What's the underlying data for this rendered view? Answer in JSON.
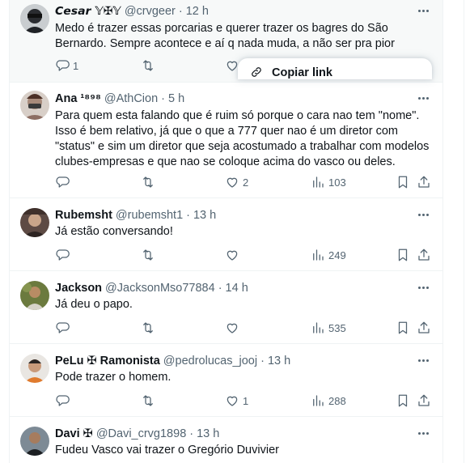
{
  "tweets": [
    {
      "name": "𝘾𝙚𝙨𝙖𝙧 𝕐✠𝕐",
      "handle": "@crvgeer",
      "dot": "·",
      "time": "12 h",
      "text": "Medo é trazer essas porcarias e querer trazer os bagres do São Bernardo. Sempre acontece e aí q nada muda, a não ser pra pior",
      "replies": "1",
      "retweets": "",
      "likes": "",
      "views": ""
    },
    {
      "name": "Ana ¹⁸⁹⁸",
      "handle": "@AthCion",
      "dot": "·",
      "time": "5 h",
      "text": "Para quem esta falando que é ruim só porque o cara nao tem \"nome\". Isso é bem relativo, já que o que a 777 quer nao é um diretor com \"status\" e sim um diretor que seja acostumado a trabalhar com modelos clubes-empresas e que nao se coloque acima do vasco ou deles.",
      "replies": "",
      "retweets": "",
      "likes": "2",
      "views": "103"
    },
    {
      "name": "Rubemsht",
      "handle": "@rubemsht1",
      "dot": "·",
      "time": "13 h",
      "text": "Já estão conversando!",
      "replies": "",
      "retweets": "",
      "likes": "",
      "views": "249"
    },
    {
      "name": "Jackson",
      "handle": "@JacksonMso77884",
      "dot": "·",
      "time": "14 h",
      "text": "Já deu o papo.",
      "replies": "",
      "retweets": "",
      "likes": "",
      "views": "535"
    },
    {
      "name": "PeLu ✠ Ramonista",
      "handle": "@pedrolucas_jooj",
      "dot": "·",
      "time": "13 h",
      "text": "Pode trazer o homem.",
      "replies": "",
      "retweets": "",
      "likes": "1",
      "views": "288"
    },
    {
      "name": "Davi ✠",
      "handle": "@Davi_crvg1898",
      "dot": "·",
      "time": "13 h",
      "text": "Fudeu Vasco vai trazer o Gregório Duvivier",
      "replies": "",
      "retweets": "",
      "likes": "",
      "views": ""
    }
  ],
  "menu": {
    "copy_link": "Copiar link"
  },
  "icons": {
    "reply": "reply-icon",
    "retweet": "retweet-icon",
    "like": "heart-icon",
    "views": "views-icon",
    "bookmark": "bookmark-icon",
    "share": "share-icon",
    "more": "more-icon",
    "link": "link-icon"
  },
  "colors": {
    "secondary_text": "#536471",
    "border": "#eff3f4",
    "highlight_bg": "#f7f9f9"
  }
}
